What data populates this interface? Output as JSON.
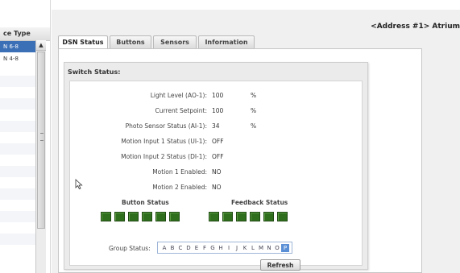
{
  "left_panel": {
    "header": "ce Type",
    "rows": [
      "N 6-8",
      "N 4-8"
    ],
    "scroll_up_icon": "▲"
  },
  "header": {
    "address": "<Address #1>  Atrium"
  },
  "tabs": [
    "DSN Status",
    "Buttons",
    "Sensors",
    "Information"
  ],
  "switch_status": {
    "title": "Switch Status:",
    "fields": [
      {
        "label": "Light Level (AO-1):",
        "value": "100",
        "unit": "%"
      },
      {
        "label": "Current Setpoint:",
        "value": "100",
        "unit": "%"
      },
      {
        "label": "Photo Sensor Status (AI-1):",
        "value": "34",
        "unit": "%"
      },
      {
        "label": "Motion Input 1 Status (UI-1):",
        "value": "OFF",
        "unit": ""
      },
      {
        "label": "Motion Input 2 Status (DI-1):",
        "value": "OFF",
        "unit": ""
      },
      {
        "label": "Motion 1 Enabled:",
        "value": "NO",
        "unit": ""
      },
      {
        "label": "Motion 2 Enabled:",
        "value": "NO",
        "unit": ""
      }
    ],
    "button_status_label": "Button Status",
    "feedback_status_label": "Feedback Status",
    "led_color": "#2f6e1c",
    "group_status_label": "Group Status:",
    "group_letters": [
      "A",
      "B",
      "C",
      "D",
      "E",
      "F",
      "G",
      "H",
      "I",
      "J",
      "K",
      "L",
      "M",
      "N",
      "O",
      "P"
    ],
    "selected_group": "P",
    "refresh_label": "Refresh"
  }
}
